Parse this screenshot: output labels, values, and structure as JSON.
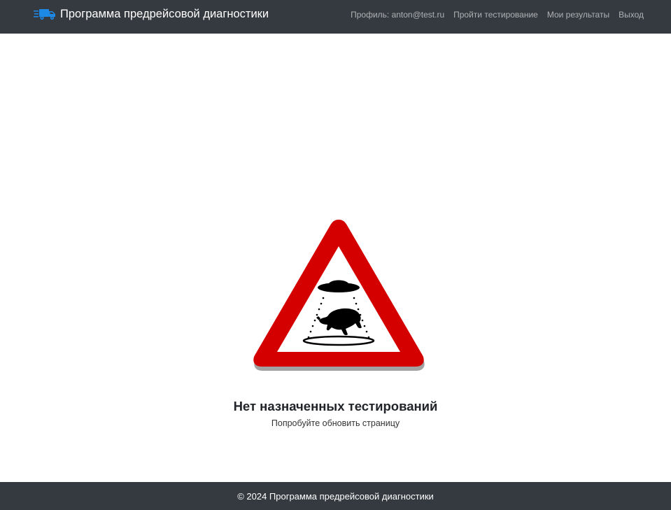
{
  "navbar": {
    "brand_title": "Программа предрейсовой диагностики",
    "brand_icon": "delivery-truck-icon",
    "links": [
      {
        "label": "Профиль: anton@test.ru"
      },
      {
        "label": "Пройти тестирование"
      },
      {
        "label": "Мои результаты"
      },
      {
        "label": "Выход"
      }
    ]
  },
  "main": {
    "illustration": "ufo-warning-sign-icon",
    "empty_title": "Нет назначенных тестирований",
    "empty_subtitle": "Попробуйте обновить страницу"
  },
  "footer": {
    "text": "© 2024 Программа предрейсовой диагностики"
  },
  "colors": {
    "navbar_bg": "#343a40",
    "brand_icon": "#1e88e5",
    "sign_red": "#d40000"
  }
}
